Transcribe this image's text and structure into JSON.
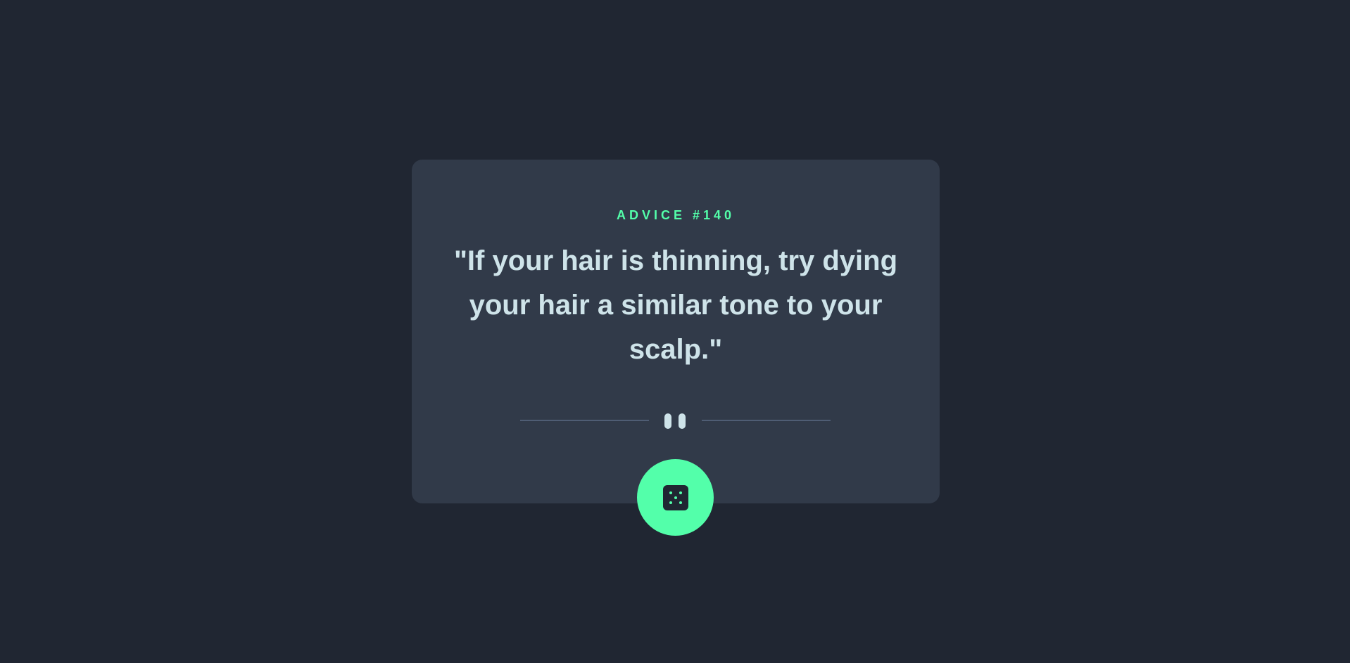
{
  "advice": {
    "id_label": "ADVICE #140",
    "quote": "\"If your hair is thinning, try dying your hair a similar tone to your scalp.\""
  },
  "divider": {
    "icon": "pause-icon"
  },
  "actions": {
    "generate_icon": "dice-icon"
  },
  "colors": {
    "background": "#202632",
    "card": "#313a49",
    "accent": "#53ffaa",
    "text": "#cee3e9",
    "divider": "#4f5d74"
  }
}
